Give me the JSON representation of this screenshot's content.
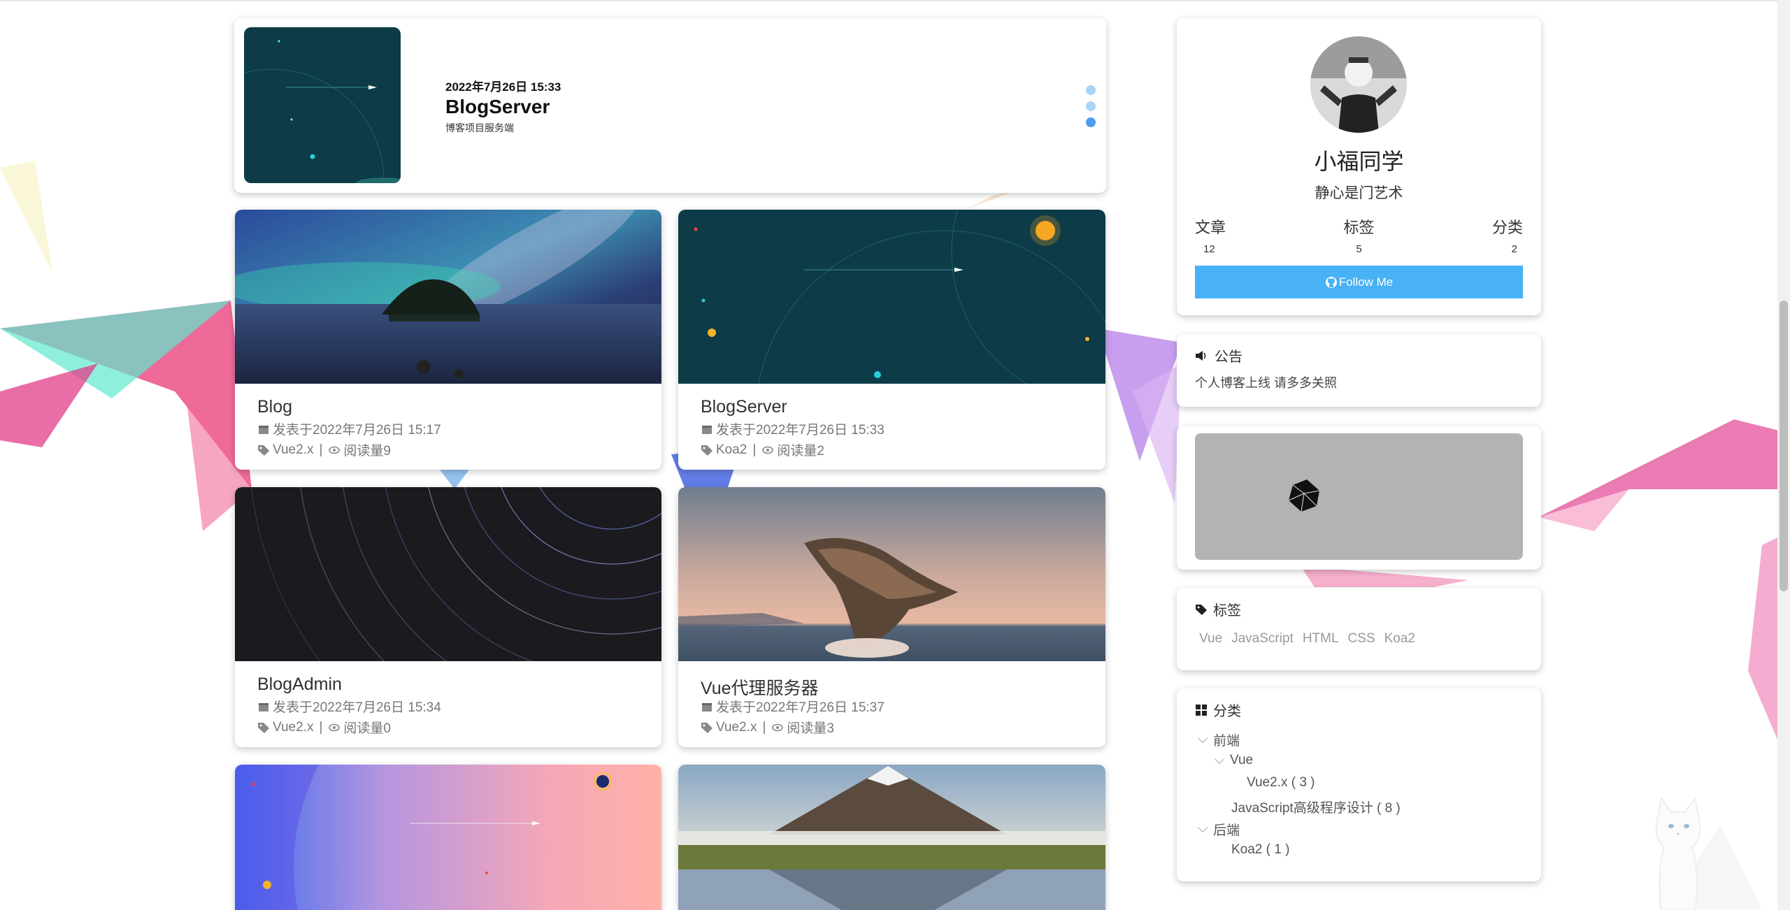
{
  "carousel": {
    "date": "2022年7月26日 15:33",
    "title": "BlogServer",
    "subtitle": "博客项目服务端"
  },
  "posts": [
    {
      "title": "Blog",
      "date": "发表于2022年7月26日 15:17",
      "tag": "Vue2.x",
      "views": "阅读量9"
    },
    {
      "title": "BlogServer",
      "date": "发表于2022年7月26日 15:33",
      "tag": "Koa2",
      "views": "阅读量2"
    },
    {
      "title": "BlogAdmin",
      "date": "发表于2022年7月26日 15:34",
      "tag": "Vue2.x",
      "views": "阅读量0"
    },
    {
      "title": "Vue代理服务器",
      "date": "发表于2022年7月26日 15:37",
      "tag": "Vue2.x",
      "views": "阅读量3"
    }
  ],
  "meta_separator": "|",
  "profile": {
    "name": "小福同学",
    "motto": "静心是门艺术",
    "stats": [
      {
        "label": "文章",
        "value": "12"
      },
      {
        "label": "标签",
        "value": "5"
      },
      {
        "label": "分类",
        "value": "2"
      }
    ],
    "follow_label": "Follow Me"
  },
  "notice": {
    "title": "公告",
    "text": "个人博客上线 请多多关照"
  },
  "tags": {
    "title": "标签",
    "items": [
      "Vue",
      "JavaScript",
      "HTML",
      "CSS",
      "Koa2"
    ]
  },
  "categories": {
    "title": "分类",
    "tree": [
      {
        "label": "前端"
      },
      {
        "label": "Vue"
      },
      {
        "label": "Vue2.x ( 3 )"
      },
      {
        "label": "JavaScript高级程序设计 ( 8 )"
      },
      {
        "label": "后端"
      },
      {
        "label": "Koa2 ( 1 )"
      }
    ]
  },
  "colors": {
    "accent": "#4cb0f5",
    "follow_bg": "#49b1f5",
    "meta_text": "#777777",
    "card_dark": "#0d3b47"
  }
}
